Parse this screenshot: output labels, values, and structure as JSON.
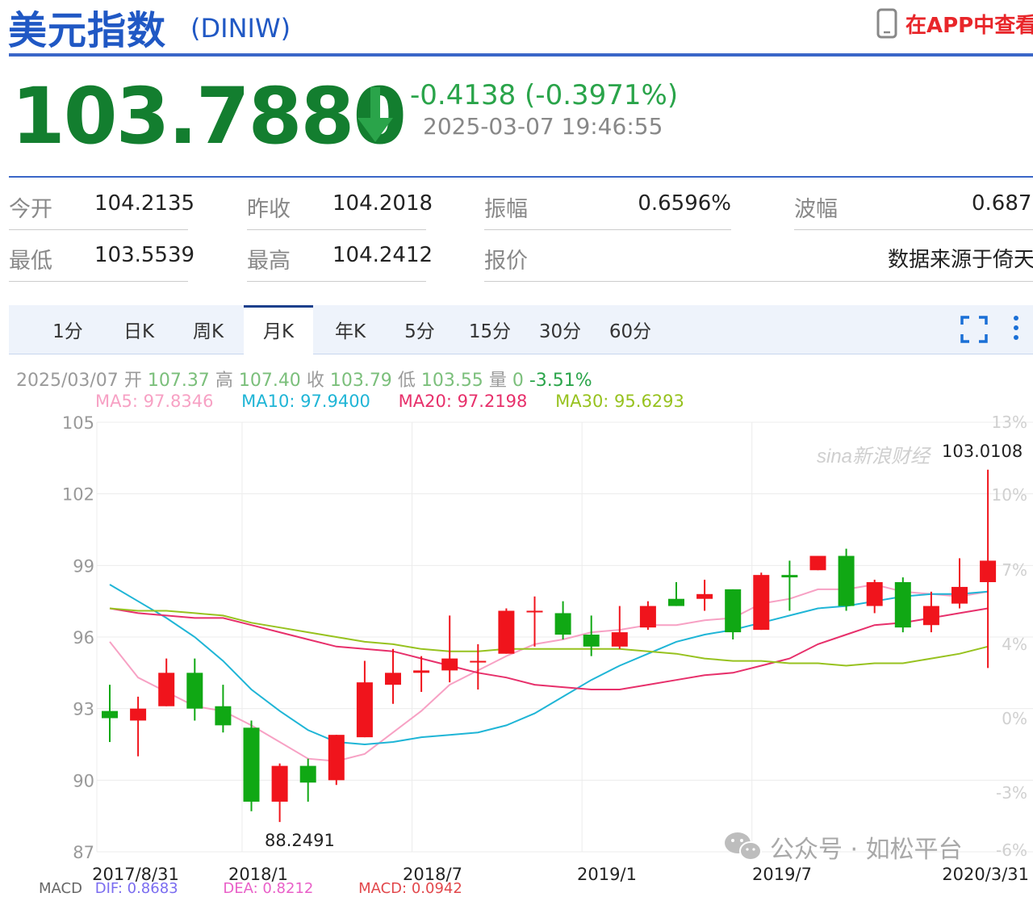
{
  "header": {
    "title": "美元指数",
    "code": "(DINIW)",
    "app_link": "在APP中查看"
  },
  "quote": {
    "price": "103.7880",
    "change": "-0.4138 (-0.3971%)",
    "time": "2025-03-07 19:46:55"
  },
  "stats": [
    {
      "label": "今开",
      "value": "104.2135"
    },
    {
      "label": "昨收",
      "value": "104.2018"
    },
    {
      "label": "振幅",
      "value": "0.6596%"
    },
    {
      "label": "波幅",
      "value": "0.6873"
    },
    {
      "label": "最低",
      "value": "103.5539"
    },
    {
      "label": "最高",
      "value": "104.2412"
    },
    {
      "label": "报价",
      "value": "数据来源于倚天"
    }
  ],
  "tabs": [
    "1分",
    "日K",
    "周K",
    "月K",
    "年K",
    "5分",
    "15分",
    "30分",
    "60分"
  ],
  "active_tab": "月K",
  "ohlc": {
    "date": "2025/03/07",
    "open_label": "开",
    "open": "107.37",
    "high_label": "高",
    "high": "107.40",
    "close_label": "收",
    "close": "103.79",
    "low_label": "低",
    "low": "103.55",
    "vol_label": "量",
    "vol": "0",
    "pct": "-3.51%"
  },
  "ma": {
    "ma5": "MA5: 97.8346",
    "ma10": "MA10: 97.9400",
    "ma20": "MA20: 97.2198",
    "ma30": "MA30: 95.6293"
  },
  "macd": {
    "dif": "DIF: 0.8683",
    "dea": "DEA: 0.8212",
    "macd": "MACD: 0.0942"
  },
  "watermark": {
    "brand": "sina新浪财经",
    "wechat": "公众号 · 如松平台"
  },
  "colors": {
    "up": "#f0141c",
    "down": "#10a814",
    "ma5": "#f7a1c4",
    "ma10": "#1fb5d6",
    "ma20": "#e7306b",
    "ma30": "#97c21f",
    "brand_blue": "#2058c4"
  },
  "chart_data": {
    "type": "candlestick",
    "y_ticks": [
      105,
      102,
      99,
      96,
      93,
      90,
      87
    ],
    "ylim": [
      87,
      105
    ],
    "pct_ticks": [
      "13%",
      "10%",
      "7%",
      "4%",
      "0%",
      "-3%",
      "-6%"
    ],
    "x_ticks": [
      "2017/8/31",
      "2018/1",
      "2018/7",
      "2019/1",
      "2019/7",
      "2020/3/31"
    ],
    "grid": true,
    "annotations": [
      {
        "text": "88.2491",
        "x": "2018/3",
        "y": 88.2491
      },
      {
        "text": "103.0108",
        "x": "2020/3",
        "y": 103.0108
      }
    ],
    "candles": [
      {
        "x": "2017/8",
        "o": 92.9,
        "h": 94.0,
        "l": 91.6,
        "c": 92.6
      },
      {
        "x": "2017/9",
        "o": 92.5,
        "h": 93.5,
        "l": 91.0,
        "c": 93.0
      },
      {
        "x": "2017/10",
        "o": 93.1,
        "h": 95.1,
        "l": 93.1,
        "c": 94.5
      },
      {
        "x": "2017/11",
        "o": 94.5,
        "h": 95.1,
        "l": 92.5,
        "c": 93.0
      },
      {
        "x": "2017/12",
        "o": 93.1,
        "h": 94.0,
        "l": 92.0,
        "c": 92.3
      },
      {
        "x": "2018/1",
        "o": 92.2,
        "h": 92.5,
        "l": 88.7,
        "c": 89.1
      },
      {
        "x": "2018/2",
        "o": 89.1,
        "h": 90.7,
        "l": 88.2491,
        "c": 90.6
      },
      {
        "x": "2018/3",
        "o": 90.6,
        "h": 90.9,
        "l": 89.1,
        "c": 89.9
      },
      {
        "x": "2018/4",
        "o": 90.0,
        "h": 91.9,
        "l": 89.8,
        "c": 91.9
      },
      {
        "x": "2018/5",
        "o": 91.8,
        "h": 95.0,
        "l": 91.8,
        "c": 94.1
      },
      {
        "x": "2018/6",
        "o": 94.0,
        "h": 95.5,
        "l": 93.2,
        "c": 94.5
      },
      {
        "x": "2018/7",
        "o": 94.5,
        "h": 95.2,
        "l": 93.7,
        "c": 94.6
      },
      {
        "x": "2018/8",
        "o": 94.6,
        "h": 96.9,
        "l": 94.1,
        "c": 95.1
      },
      {
        "x": "2018/9",
        "o": 95.0,
        "h": 95.7,
        "l": 93.8,
        "c": 95.0
      },
      {
        "x": "2018/10",
        "o": 95.3,
        "h": 97.2,
        "l": 95.3,
        "c": 97.1
      },
      {
        "x": "2018/11",
        "o": 97.1,
        "h": 97.7,
        "l": 95.6,
        "c": 97.1
      },
      {
        "x": "2018/12",
        "o": 97.0,
        "h": 97.5,
        "l": 95.9,
        "c": 96.1
      },
      {
        "x": "2019/1",
        "o": 96.1,
        "h": 96.9,
        "l": 95.2,
        "c": 95.6
      },
      {
        "x": "2019/2",
        "o": 95.6,
        "h": 97.3,
        "l": 95.5,
        "c": 96.2
      },
      {
        "x": "2019/3",
        "o": 96.4,
        "h": 97.5,
        "l": 96.3,
        "c": 97.3
      },
      {
        "x": "2019/4",
        "o": 97.6,
        "h": 98.3,
        "l": 97.3,
        "c": 97.3
      },
      {
        "x": "2019/5",
        "o": 97.6,
        "h": 98.4,
        "l": 97.1,
        "c": 97.8
      },
      {
        "x": "2019/6",
        "o": 98.0,
        "h": 98.0,
        "l": 95.9,
        "c": 96.2
      },
      {
        "x": "2019/7",
        "o": 96.3,
        "h": 98.7,
        "l": 96.3,
        "c": 98.6
      },
      {
        "x": "2019/8",
        "o": 98.6,
        "h": 99.2,
        "l": 97.1,
        "c": 98.5
      },
      {
        "x": "2019/9",
        "o": 98.8,
        "h": 99.4,
        "l": 98.8,
        "c": 99.4
      },
      {
        "x": "2019/10",
        "o": 99.4,
        "h": 99.7,
        "l": 97.1,
        "c": 97.3
      },
      {
        "x": "2019/11",
        "o": 97.3,
        "h": 98.4,
        "l": 97.0,
        "c": 98.3
      },
      {
        "x": "2019/12",
        "o": 98.3,
        "h": 98.5,
        "l": 96.2,
        "c": 96.4
      },
      {
        "x": "2020/1",
        "o": 96.5,
        "h": 97.9,
        "l": 96.2,
        "c": 97.3
      },
      {
        "x": "2020/2",
        "o": 97.4,
        "h": 99.3,
        "l": 97.2,
        "c": 98.1
      },
      {
        "x": "2020/3",
        "o": 98.3,
        "h": 103.0108,
        "l": 94.7,
        "c": 99.2
      }
    ],
    "series": [
      {
        "name": "MA5",
        "values": [
          95.8,
          94.3,
          93.7,
          93.1,
          92.9,
          92.3,
          91.6,
          90.9,
          90.8,
          91.1,
          92.0,
          92.9,
          94.0,
          94.6,
          95.2,
          95.7,
          95.9,
          96.2,
          96.3,
          96.5,
          96.5,
          96.7,
          96.8,
          97.4,
          97.6,
          98.0,
          98.0,
          98.2,
          97.9,
          97.8,
          97.7,
          97.9
        ]
      },
      {
        "name": "MA10",
        "values": [
          98.2,
          97.5,
          96.8,
          96.0,
          95.0,
          93.8,
          92.9,
          92.1,
          91.6,
          91.5,
          91.6,
          91.8,
          91.9,
          92.0,
          92.3,
          92.8,
          93.5,
          94.2,
          94.8,
          95.3,
          95.8,
          96.1,
          96.3,
          96.6,
          96.9,
          97.2,
          97.3,
          97.5,
          97.7,
          97.8,
          97.8,
          97.9
        ]
      },
      {
        "name": "MA20",
        "values": [
          97.2,
          97.0,
          96.9,
          96.8,
          96.8,
          96.5,
          96.2,
          95.9,
          95.6,
          95.5,
          95.4,
          95.1,
          94.8,
          94.5,
          94.3,
          94.0,
          93.9,
          93.8,
          93.8,
          94.0,
          94.2,
          94.4,
          94.5,
          94.8,
          95.1,
          95.7,
          96.1,
          96.5,
          96.6,
          96.8,
          97.0,
          97.2
        ]
      },
      {
        "name": "MA30",
        "values": [
          97.2,
          97.1,
          97.1,
          97.0,
          96.9,
          96.6,
          96.4,
          96.2,
          96.0,
          95.8,
          95.7,
          95.5,
          95.4,
          95.4,
          95.5,
          95.5,
          95.5,
          95.5,
          95.5,
          95.4,
          95.3,
          95.1,
          95.0,
          95.0,
          94.9,
          94.9,
          94.8,
          94.9,
          94.9,
          95.1,
          95.3,
          95.6
        ]
      }
    ]
  }
}
